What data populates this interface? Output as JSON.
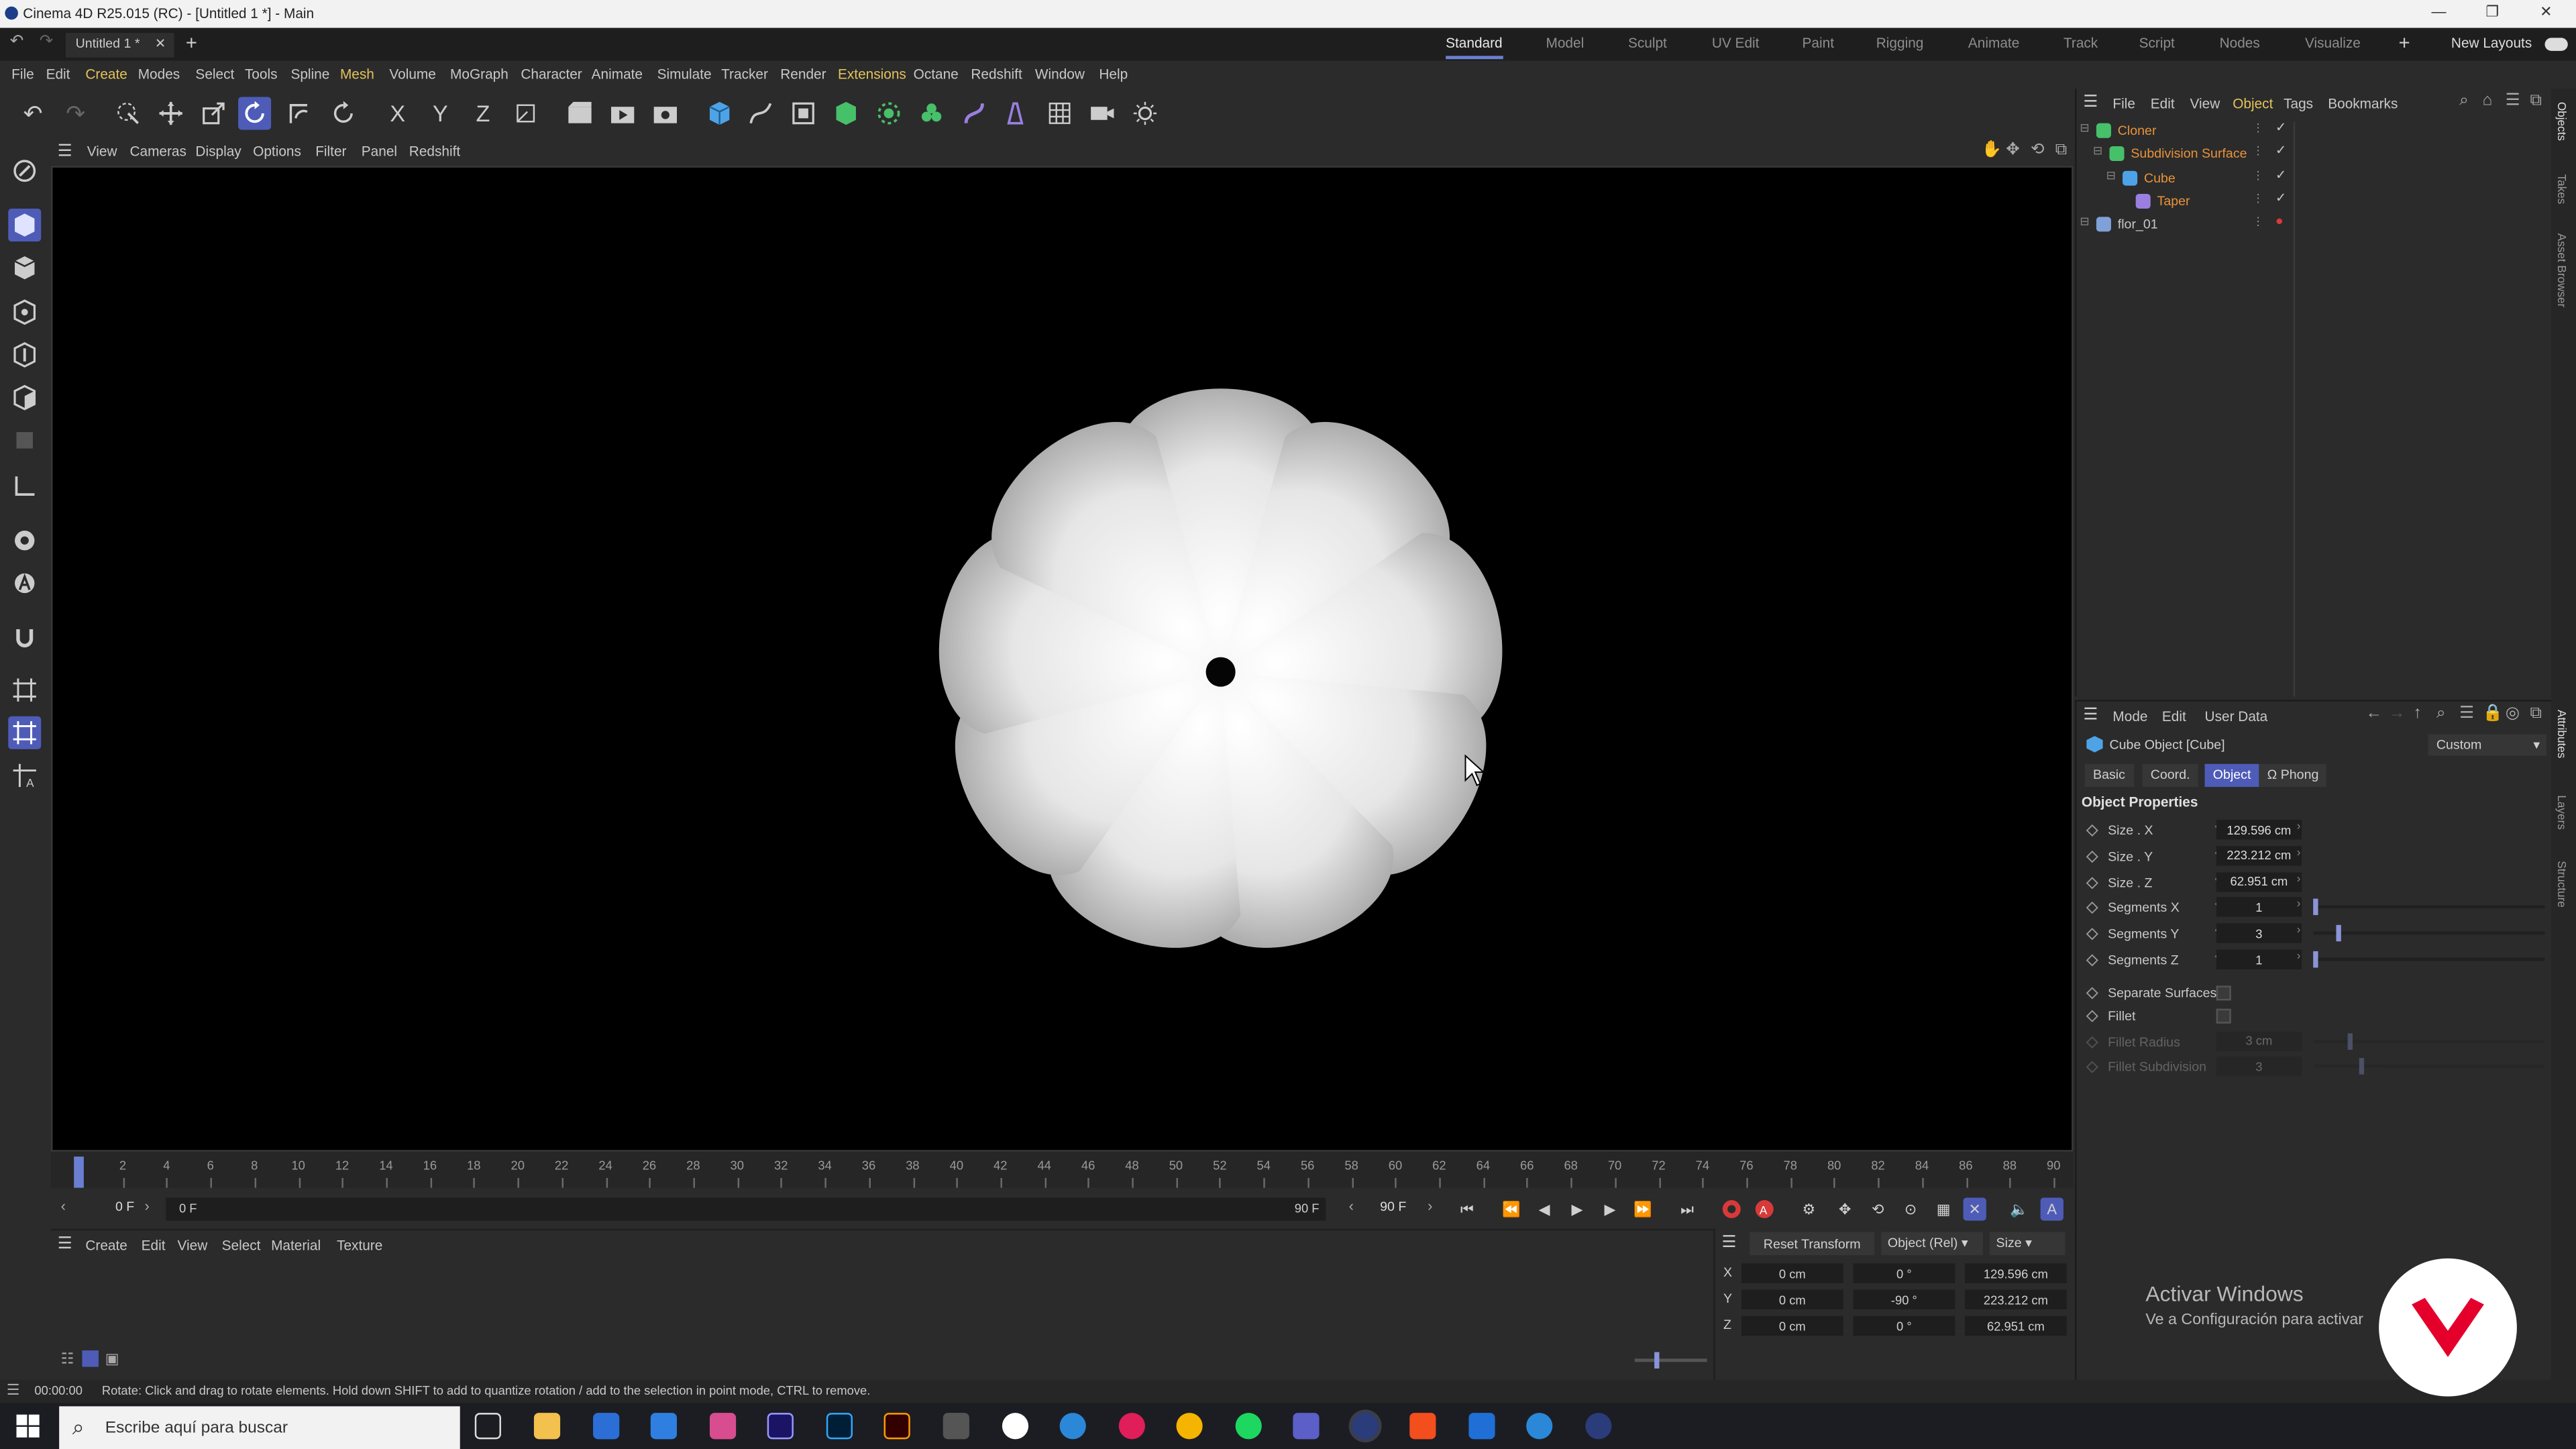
{
  "window": {
    "title": "Cinema 4D R25.015 (RC) - [Untitled 1 *] - Main"
  },
  "doc_tab": {
    "label": "Untitled 1 *"
  },
  "layouts": {
    "items": [
      "Standard",
      "Model",
      "Sculpt",
      "UV Edit",
      "Paint",
      "Rigging",
      "Animate",
      "Track",
      "Script",
      "Nodes",
      "Visualize"
    ],
    "active": "Standard",
    "new_layouts": "New Layouts"
  },
  "menu": {
    "items": [
      "File",
      "Edit",
      "Create",
      "Modes",
      "Select",
      "Tools",
      "Spline",
      "Mesh",
      "Volume",
      "MoGraph",
      "Character",
      "Animate",
      "Simulate",
      "Tracker",
      "Render",
      "Extensions",
      "Octane",
      "Redshift",
      "Window",
      "Help"
    ]
  },
  "toolbar": {
    "axis_x": "X",
    "axis_y": "Y",
    "axis_z": "Z"
  },
  "viewport_menu": {
    "items": [
      "View",
      "Cameras",
      "Display",
      "Options",
      "Filter",
      "Panel",
      "Redshift"
    ]
  },
  "timeline": {
    "ticks": [
      "0",
      "2",
      "4",
      "6",
      "8",
      "10",
      "12",
      "14",
      "16",
      "18",
      "20",
      "22",
      "24",
      "26",
      "28",
      "30",
      "32",
      "34",
      "36",
      "38",
      "40",
      "42",
      "44",
      "46",
      "48",
      "50",
      "52",
      "54",
      "56",
      "58",
      "60",
      "62",
      "64",
      "66",
      "68",
      "70",
      "72",
      "74",
      "76",
      "78",
      "80",
      "82",
      "84",
      "86",
      "88",
      "90"
    ],
    "current_frame": "0 F",
    "range_start": "0 F",
    "range_end": "90 F",
    "end_frame": "90 F"
  },
  "material_manager": {
    "menu": [
      "Create",
      "Edit",
      "View",
      "Select",
      "Material",
      "Texture"
    ]
  },
  "coordinates": {
    "reset_label": "Reset Transform",
    "mode": "Object (Rel)",
    "size_mode": "Size",
    "rows": [
      {
        "axis": "X",
        "pos": "0 cm",
        "rot": "0 °",
        "size": "129.596 cm"
      },
      {
        "axis": "Y",
        "pos": "0 cm",
        "rot": "-90 °",
        "size": "223.212 cm"
      },
      {
        "axis": "Z",
        "pos": "0 cm",
        "rot": "0 °",
        "size": "62.951 cm"
      }
    ]
  },
  "objects_panel": {
    "menu": [
      "File",
      "Edit",
      "View",
      "Object",
      "Tags",
      "Bookmarks"
    ],
    "items": [
      {
        "name": "Cloner",
        "color": "#e8933a"
      },
      {
        "name": "Subdivision Surface",
        "color": "#e8933a"
      },
      {
        "name": "Cube",
        "color": "#e8933a"
      },
      {
        "name": "Taper",
        "color": "#e8933a"
      },
      {
        "name": "flor_01",
        "color": "#c8c8c8"
      }
    ]
  },
  "attributes": {
    "menu": [
      "Mode",
      "Edit",
      "User Data"
    ],
    "object_title": "Cube Object [Cube]",
    "preset": "Custom",
    "tabs": [
      "Basic",
      "Coord.",
      "Object",
      "Phong"
    ],
    "active_tab": "Object",
    "section": "Object Properties",
    "props": [
      {
        "label": "Size . X",
        "value": "129.596 cm"
      },
      {
        "label": "Size . Y",
        "value": "223.212 cm"
      },
      {
        "label": "Size . Z",
        "value": "62.951 cm"
      },
      {
        "label": "Segments X",
        "value": "1",
        "level": 0.0
      },
      {
        "label": "Segments Y",
        "value": "3",
        "level": 0.1
      },
      {
        "label": "Segments Z",
        "value": "1",
        "level": 0.0
      }
    ],
    "checks": [
      {
        "label": "Separate Surfaces"
      },
      {
        "label": "Fillet"
      }
    ],
    "disabled": [
      {
        "label": "Fillet Radius",
        "value": "3 cm",
        "level": 0.15
      },
      {
        "label": "Fillet Subdivision",
        "value": "3",
        "level": 0.2
      }
    ]
  },
  "right_strip": [
    "Objects",
    "Takes",
    "Asset Browser",
    "Attributes",
    "Layers",
    "Structure"
  ],
  "status": {
    "time": "00:00:00",
    "hint": "Rotate: Click and drag to rotate elements. Hold down SHIFT to add to quantize rotation / add to the selection in point mode, CTRL to remove."
  },
  "taskbar": {
    "search_placeholder": "Escribe aquí para buscar"
  },
  "watermark": {
    "line1": "Activar Windows",
    "line2": "Ve a Configuración para activar"
  },
  "colors": {
    "accent": "#6a7fd1",
    "active_tab": "#4e5cb8",
    "record": "#d83a3a",
    "object_orange": "#e8933a"
  }
}
